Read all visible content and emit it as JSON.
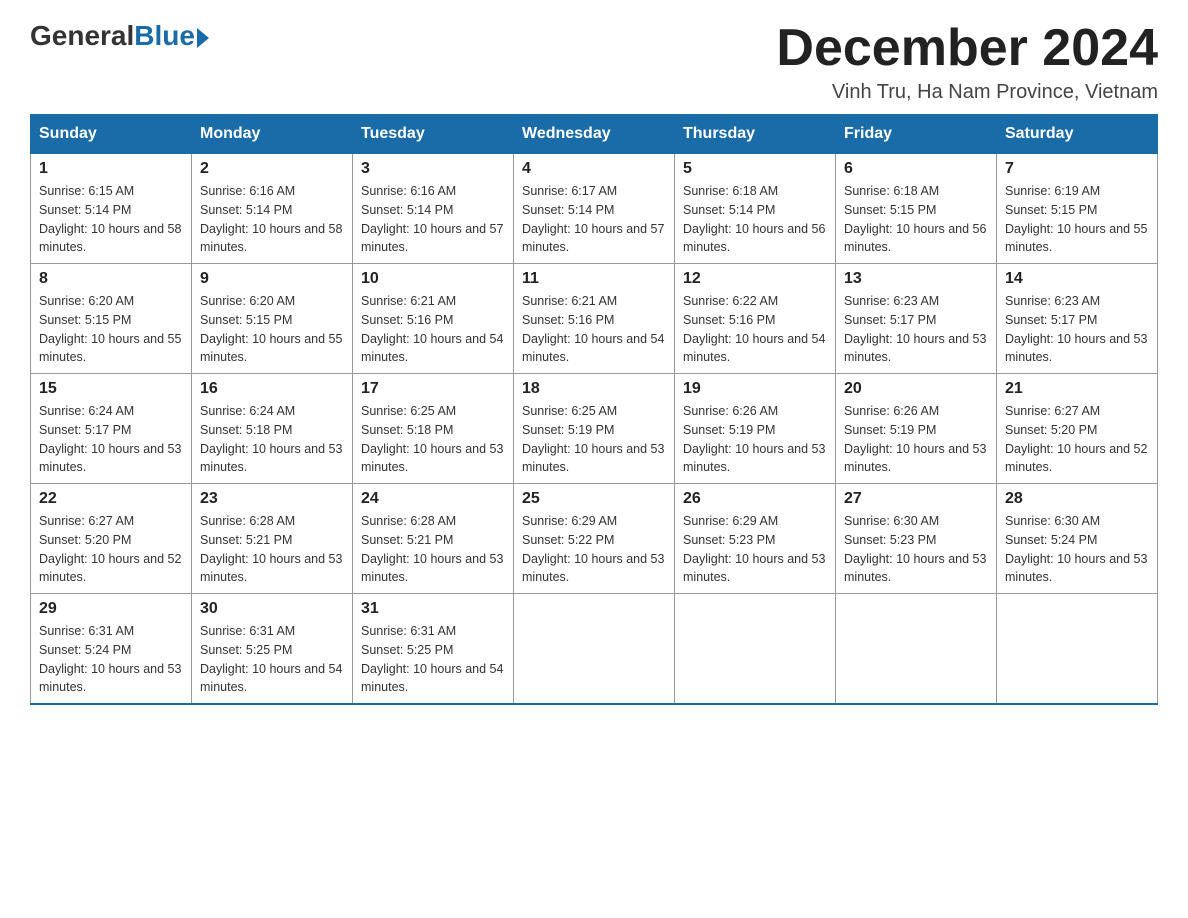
{
  "header": {
    "logo_general": "General",
    "logo_blue": "Blue",
    "month_title": "December 2024",
    "location": "Vinh Tru, Ha Nam Province, Vietnam"
  },
  "weekdays": [
    "Sunday",
    "Monday",
    "Tuesday",
    "Wednesday",
    "Thursday",
    "Friday",
    "Saturday"
  ],
  "weeks": [
    [
      {
        "day": "1",
        "sunrise": "6:15 AM",
        "sunset": "5:14 PM",
        "daylight": "10 hours and 58 minutes."
      },
      {
        "day": "2",
        "sunrise": "6:16 AM",
        "sunset": "5:14 PM",
        "daylight": "10 hours and 58 minutes."
      },
      {
        "day": "3",
        "sunrise": "6:16 AM",
        "sunset": "5:14 PM",
        "daylight": "10 hours and 57 minutes."
      },
      {
        "day": "4",
        "sunrise": "6:17 AM",
        "sunset": "5:14 PM",
        "daylight": "10 hours and 57 minutes."
      },
      {
        "day": "5",
        "sunrise": "6:18 AM",
        "sunset": "5:14 PM",
        "daylight": "10 hours and 56 minutes."
      },
      {
        "day": "6",
        "sunrise": "6:18 AM",
        "sunset": "5:15 PM",
        "daylight": "10 hours and 56 minutes."
      },
      {
        "day": "7",
        "sunrise": "6:19 AM",
        "sunset": "5:15 PM",
        "daylight": "10 hours and 55 minutes."
      }
    ],
    [
      {
        "day": "8",
        "sunrise": "6:20 AM",
        "sunset": "5:15 PM",
        "daylight": "10 hours and 55 minutes."
      },
      {
        "day": "9",
        "sunrise": "6:20 AM",
        "sunset": "5:15 PM",
        "daylight": "10 hours and 55 minutes."
      },
      {
        "day": "10",
        "sunrise": "6:21 AM",
        "sunset": "5:16 PM",
        "daylight": "10 hours and 54 minutes."
      },
      {
        "day": "11",
        "sunrise": "6:21 AM",
        "sunset": "5:16 PM",
        "daylight": "10 hours and 54 minutes."
      },
      {
        "day": "12",
        "sunrise": "6:22 AM",
        "sunset": "5:16 PM",
        "daylight": "10 hours and 54 minutes."
      },
      {
        "day": "13",
        "sunrise": "6:23 AM",
        "sunset": "5:17 PM",
        "daylight": "10 hours and 53 minutes."
      },
      {
        "day": "14",
        "sunrise": "6:23 AM",
        "sunset": "5:17 PM",
        "daylight": "10 hours and 53 minutes."
      }
    ],
    [
      {
        "day": "15",
        "sunrise": "6:24 AM",
        "sunset": "5:17 PM",
        "daylight": "10 hours and 53 minutes."
      },
      {
        "day": "16",
        "sunrise": "6:24 AM",
        "sunset": "5:18 PM",
        "daylight": "10 hours and 53 minutes."
      },
      {
        "day": "17",
        "sunrise": "6:25 AM",
        "sunset": "5:18 PM",
        "daylight": "10 hours and 53 minutes."
      },
      {
        "day": "18",
        "sunrise": "6:25 AM",
        "sunset": "5:19 PM",
        "daylight": "10 hours and 53 minutes."
      },
      {
        "day": "19",
        "sunrise": "6:26 AM",
        "sunset": "5:19 PM",
        "daylight": "10 hours and 53 minutes."
      },
      {
        "day": "20",
        "sunrise": "6:26 AM",
        "sunset": "5:19 PM",
        "daylight": "10 hours and 53 minutes."
      },
      {
        "day": "21",
        "sunrise": "6:27 AM",
        "sunset": "5:20 PM",
        "daylight": "10 hours and 52 minutes."
      }
    ],
    [
      {
        "day": "22",
        "sunrise": "6:27 AM",
        "sunset": "5:20 PM",
        "daylight": "10 hours and 52 minutes."
      },
      {
        "day": "23",
        "sunrise": "6:28 AM",
        "sunset": "5:21 PM",
        "daylight": "10 hours and 53 minutes."
      },
      {
        "day": "24",
        "sunrise": "6:28 AM",
        "sunset": "5:21 PM",
        "daylight": "10 hours and 53 minutes."
      },
      {
        "day": "25",
        "sunrise": "6:29 AM",
        "sunset": "5:22 PM",
        "daylight": "10 hours and 53 minutes."
      },
      {
        "day": "26",
        "sunrise": "6:29 AM",
        "sunset": "5:23 PM",
        "daylight": "10 hours and 53 minutes."
      },
      {
        "day": "27",
        "sunrise": "6:30 AM",
        "sunset": "5:23 PM",
        "daylight": "10 hours and 53 minutes."
      },
      {
        "day": "28",
        "sunrise": "6:30 AM",
        "sunset": "5:24 PM",
        "daylight": "10 hours and 53 minutes."
      }
    ],
    [
      {
        "day": "29",
        "sunrise": "6:31 AM",
        "sunset": "5:24 PM",
        "daylight": "10 hours and 53 minutes."
      },
      {
        "day": "30",
        "sunrise": "6:31 AM",
        "sunset": "5:25 PM",
        "daylight": "10 hours and 54 minutes."
      },
      {
        "day": "31",
        "sunrise": "6:31 AM",
        "sunset": "5:25 PM",
        "daylight": "10 hours and 54 minutes."
      },
      null,
      null,
      null,
      null
    ]
  ]
}
